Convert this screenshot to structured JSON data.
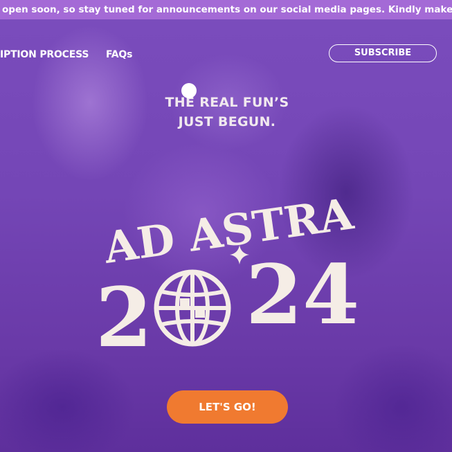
{
  "announcement": {
    "text": "open soon, so stay tuned for announcements on our social media pages. Kindly make sure to submit"
  },
  "nav": {
    "items": [
      {
        "label": "IPTION PROCESS"
      },
      {
        "label": "FAQs"
      }
    ],
    "subscribe_label": "SUBSCRIBE"
  },
  "hero": {
    "tagline_line1": "THE REAL FUN’S",
    "tagline_line2": "JUST BEGUN.",
    "logo_line1": "AD ASTRA",
    "logo_year_first": "2",
    "logo_year_last": "24",
    "logo_globe_icon": "disco-globe-icon",
    "logo_sparkle_icon": "sparkle-icon",
    "cta_label": "LET'S GO!"
  },
  "colors": {
    "announcement_bar": "#a46ad6",
    "hero_overlay": "#7446b6",
    "logo_text": "#f5ede6",
    "cta_button": "#f07a30"
  }
}
